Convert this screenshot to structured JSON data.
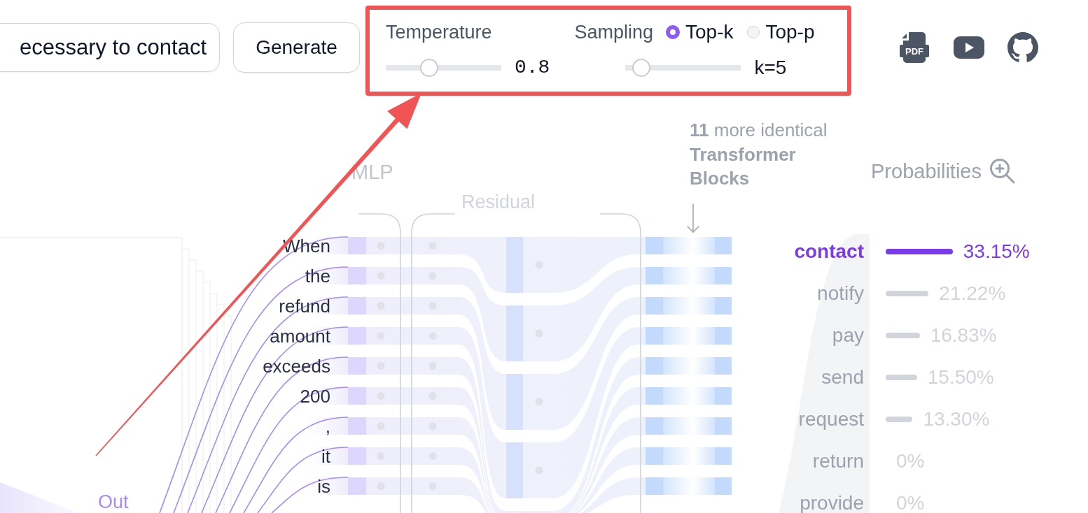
{
  "prompt_input": {
    "value": "ecessary to contact"
  },
  "generate_button": {
    "label": "Generate"
  },
  "controls": {
    "temperature": {
      "label": "Temperature",
      "level": 0.35,
      "reading": "0.8"
    },
    "sampling": {
      "label": "Sampling",
      "options": [
        {
          "label": "Top-k",
          "selected": true
        },
        {
          "label": "Top-p",
          "selected": false
        }
      ],
      "slider": {
        "level": 0.07,
        "reading": "k=5"
      }
    }
  },
  "links": [
    {
      "kind": "pdf",
      "label": "PDF"
    },
    {
      "kind": "video"
    },
    {
      "kind": "github"
    }
  ],
  "diagram": {
    "mlp_label": "MLP",
    "residual_label": "Residual",
    "blocks_note": "**11** more identical **Transformer Blocks**",
    "tokens": [
      "When",
      "the",
      "refund",
      "amount",
      "exceeds",
      "200",
      ",",
      "it",
      "is"
    ],
    "out_label": "Out"
  },
  "probabilities": {
    "title": "Probabilities",
    "rows": [
      {
        "token": "contact",
        "level": 0.3315,
        "reading": "33.15%",
        "selected": true
      },
      {
        "token": "notify",
        "level": 0.2122,
        "reading": "21.22%",
        "selected": false
      },
      {
        "token": "pay",
        "level": 0.1683,
        "reading": "16.83%",
        "selected": false
      },
      {
        "token": "send",
        "level": 0.155,
        "reading": "15.50%",
        "selected": false
      },
      {
        "token": "request",
        "level": 0.133,
        "reading": "13.30%",
        "selected": false
      },
      {
        "token": "return",
        "reading": "0%",
        "selected": false
      },
      {
        "token": "provide",
        "reading": "0%",
        "selected": false
      }
    ]
  }
}
